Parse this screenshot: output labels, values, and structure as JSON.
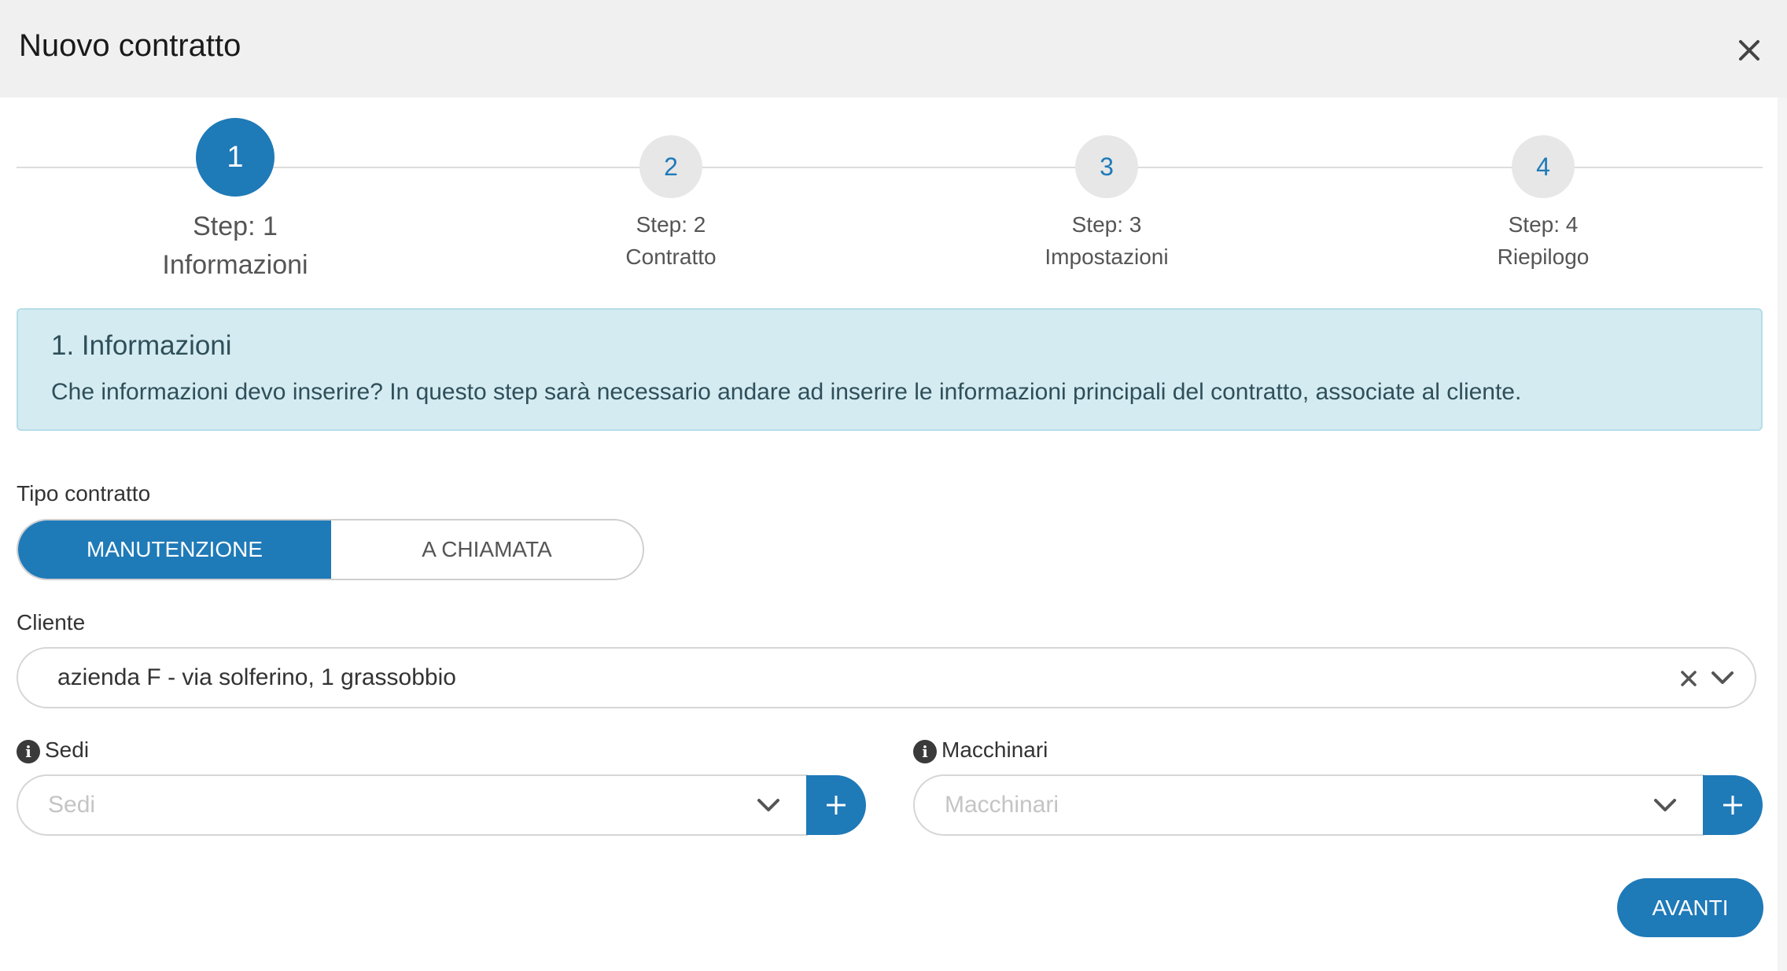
{
  "dialog": {
    "title": "Nuovo contratto"
  },
  "stepper": {
    "steps": [
      {
        "number": "1",
        "step_label": "Step: 1",
        "name": "Informazioni",
        "active": true
      },
      {
        "number": "2",
        "step_label": "Step: 2",
        "name": "Contratto",
        "active": false
      },
      {
        "number": "3",
        "step_label": "Step: 3",
        "name": "Impostazioni",
        "active": false
      },
      {
        "number": "4",
        "step_label": "Step: 4",
        "name": "Riepilogo",
        "active": false
      }
    ]
  },
  "info_box": {
    "heading": "1. Informazioni",
    "text": "Che informazioni devo inserire? In questo step sarà necessario andare ad inserire le informazioni principali del contratto, associate al cliente."
  },
  "form": {
    "tipo_contratto": {
      "label": "Tipo contratto",
      "options": [
        "MANUTENZIONE",
        "A CHIAMATA"
      ],
      "selected": "MANUTENZIONE"
    },
    "cliente": {
      "label": "Cliente",
      "value": "azienda F - via solferino, 1 grassobbio"
    },
    "sedi": {
      "label": "Sedi",
      "placeholder": "Sedi",
      "add_label": "+"
    },
    "macchinari": {
      "label": "Macchinari",
      "placeholder": "Macchinari",
      "add_label": "+"
    }
  },
  "footer": {
    "next_label": "AVANTI"
  },
  "colors": {
    "primary": "#1f7ab8",
    "info_bg": "#d4ebf1",
    "header_bg": "#f0f0f0"
  },
  "icons": {
    "close": "close-icon",
    "clear": "clear-icon",
    "dropdown": "chevron-down-icon",
    "info": "info-icon",
    "add": "plus-icon"
  }
}
